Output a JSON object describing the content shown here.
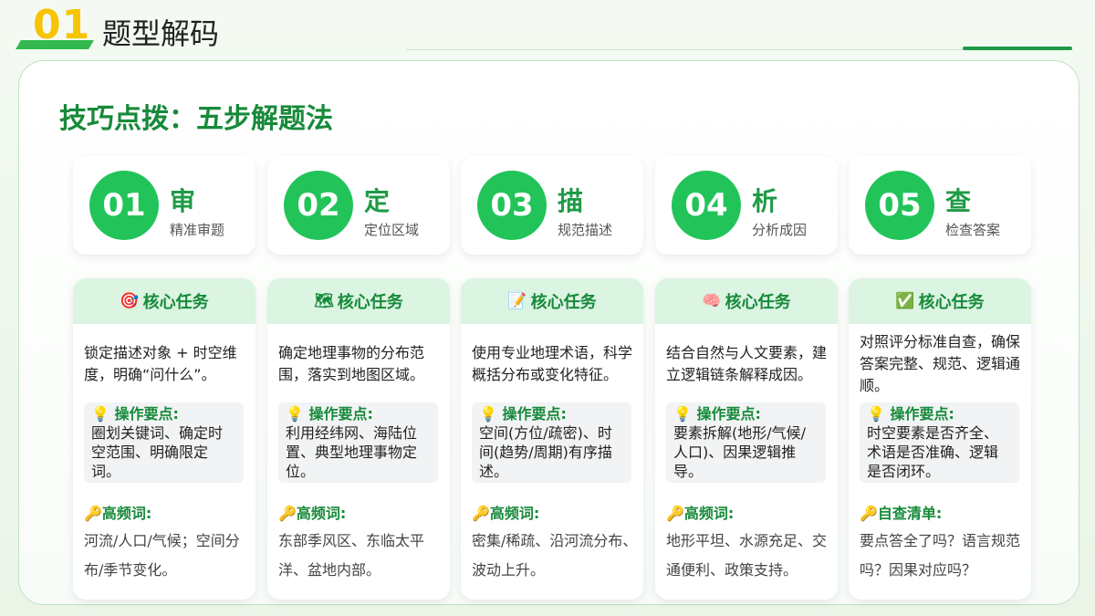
{
  "header": {
    "section_number": "01",
    "section_title": "题型解码"
  },
  "panel": {
    "title": "技巧点拨：五步解题法"
  },
  "steps": [
    {
      "num": "01",
      "char": "审",
      "sub": "精准审题"
    },
    {
      "num": "02",
      "char": "定",
      "sub": "定位区域"
    },
    {
      "num": "03",
      "char": "描",
      "sub": "规范描述"
    },
    {
      "num": "04",
      "char": "析",
      "sub": "分析成因"
    },
    {
      "num": "05",
      "char": "查",
      "sub": "检查答案"
    }
  ],
  "tasks": [
    {
      "icon": "🎯",
      "head": "核心任务",
      "desc": "锁定描述对象 + 时空维度，明确“问什么”。",
      "tips_icon": "💡",
      "tips_title": "操作要点:",
      "tips_text": "圈划关键词、确定时空范围、明确限定词。",
      "kw_icon": "🔑",
      "kw_title": "高频词:",
      "kw_text": "河流/人口/气候；空间分布/季节变化。"
    },
    {
      "icon": "🗺",
      "head": "核心任务",
      "desc": "确定地理事物的分布范围，落实到地图区域。",
      "tips_icon": "💡",
      "tips_title": "操作要点:",
      "tips_text": "利用经纬网、海陆位置、典型地理事物定位。",
      "kw_icon": "🔑",
      "kw_title": "高频词:",
      "kw_text": "东部季风区、东临太平洋、盆地内部。"
    },
    {
      "icon": "📝",
      "head": "核心任务",
      "desc": "使用专业地理术语，科学概括分布或变化特征。",
      "tips_icon": "💡",
      "tips_title": "操作要点:",
      "tips_text": "空间(方位/疏密)、时间(趋势/周期)有序描述。",
      "kw_icon": "🔑",
      "kw_title": "高频词:",
      "kw_text": "密集/稀疏、沿河流分布、波动上升。"
    },
    {
      "icon": "🧠",
      "head": "核心任务",
      "desc": "结合自然与人文要素，建立逻辑链条解释成因。",
      "tips_icon": "💡",
      "tips_title": "操作要点:",
      "tips_text": "要素拆解(地形/气候/人口)、因果逻辑推导。",
      "kw_icon": "🔑",
      "kw_title": "高频词:",
      "kw_text": "地形平坦、水源充足、交通便利、政策支持。"
    },
    {
      "icon": "✅",
      "head": "核心任务",
      "desc": "对照评分标准自查，确保答案完整、规范、逻辑通顺。",
      "tips_icon": "💡",
      "tips_title": "操作要点:",
      "tips_text": "时空要素是否齐全、术语是否准确、逻辑是否闭环。",
      "kw_icon": "🔑",
      "kw_title": "自查清单:",
      "kw_text": "要点答全了吗？语言规范吗？因果对应吗？"
    }
  ],
  "colors": {
    "accent": "#22c45a",
    "dark_green": "#178a3a",
    "yellow": "#f6c400"
  }
}
